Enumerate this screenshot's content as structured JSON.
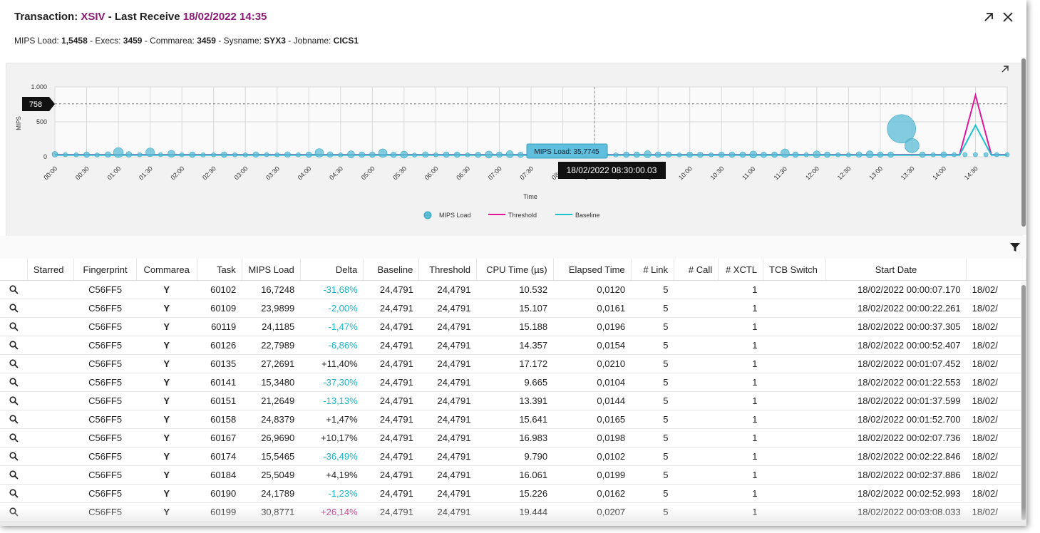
{
  "header": {
    "title_prefix": "Transaction:",
    "transaction": "XSIV",
    "mid": "- Last Receive",
    "last_receive": "18/02/2022 14:35",
    "sub": [
      {
        "label": "MIPS Load:",
        "value": "1,5458"
      },
      {
        "label": "Execs:",
        "value": "3459"
      },
      {
        "label": "Commarea:",
        "value": "3459"
      },
      {
        "label": "Sysname:",
        "value": "SYX3"
      },
      {
        "label": "Jobname:",
        "value": "CICS1"
      }
    ],
    "sep": "-"
  },
  "colors": {
    "accent": "#8c1a76",
    "mips": "#5bbcd6",
    "threshold": "#e0169b",
    "baseline": "#1bc3cf",
    "neg_delta": "#1bb4c6"
  },
  "icons": {
    "expand": "arrow-up-right-icon",
    "close": "close-icon",
    "chart_expand": "arrow-up-right-icon",
    "filter": "filter-icon",
    "row": "search-icon"
  },
  "chart_data": {
    "type": "scatter",
    "ylabel": "MIPS",
    "xlabel": "Time",
    "ylim": [
      0,
      1000
    ],
    "yticks": [
      "0",
      "500",
      "1.000"
    ],
    "xticks": [
      "00:00",
      "00:30",
      "01:00",
      "01:30",
      "02:00",
      "02:30",
      "03:00",
      "03:30",
      "04:00",
      "04:30",
      "05:00",
      "05:30",
      "06:00",
      "06:30",
      "07:00",
      "07:30",
      "08:00",
      "08:30",
      "09:00",
      "09:30",
      "10:00",
      "10:30",
      "11:00",
      "11:30",
      "12:00",
      "12:30",
      "13:00",
      "13:30",
      "14:00",
      "14:30"
    ],
    "threshold_marker": "758",
    "tooltip_series": "MIPS Load: 35,7745",
    "tooltip_time": "18/02/2022 08:30:00.03",
    "legend": [
      "MIPS Load",
      "Threshold",
      "Baseline"
    ],
    "series": [
      {
        "name": "MIPS Load",
        "kind": "bubble",
        "x": [
          0.0,
          0.33,
          0.67,
          1.0,
          1.33,
          1.67,
          2.0,
          2.33,
          2.67,
          3.0,
          3.33,
          3.67,
          4.0,
          4.33,
          4.67,
          5.0,
          5.33,
          5.67,
          6.0,
          6.33,
          6.67,
          7.0,
          7.33,
          7.67,
          8.0,
          8.33,
          8.67,
          9.0,
          9.33,
          9.67,
          10.0,
          10.33,
          10.67,
          11.0,
          11.33,
          11.67,
          12.0,
          12.33,
          12.67,
          13.0,
          13.33,
          13.67,
          14.0,
          14.33,
          14.67,
          15.0,
          15.33,
          15.67,
          16.0,
          16.33,
          16.67,
          17.0,
          17.33,
          17.67,
          18.0,
          18.33,
          18.67,
          19.0,
          19.33,
          19.67,
          20.0,
          20.33,
          20.67,
          21.0,
          21.33,
          21.67,
          22.0,
          22.33,
          22.67,
          23.0,
          23.33,
          23.67,
          24.0,
          24.33,
          24.67,
          25.0,
          25.33,
          25.67,
          26.0,
          26.33,
          26.67,
          27.0,
          27.33,
          27.67,
          28.0,
          28.33,
          28.67,
          29.0,
          29.33,
          29.67,
          30.0
        ],
        "values": [
          36,
          30,
          28,
          30,
          25,
          32,
          60,
          34,
          28,
          64,
          30,
          42,
          28,
          30,
          26,
          28,
          30,
          28,
          26,
          32,
          30,
          28,
          32,
          28,
          30,
          56,
          32,
          26,
          34,
          30,
          30,
          52,
          28,
          30,
          24,
          32,
          28,
          30,
          30,
          26,
          28,
          32,
          30,
          36,
          28,
          30,
          28,
          34,
          30,
          30,
          32,
          28,
          30,
          26,
          30,
          30,
          36,
          30,
          32,
          26,
          30,
          28,
          28,
          30,
          30,
          30,
          32,
          28,
          30,
          50,
          30,
          28,
          34,
          30,
          28,
          26,
          32,
          34,
          30,
          30,
          400,
          160,
          30,
          28,
          30,
          30,
          30,
          30,
          30,
          30,
          30
        ],
        "sizes": [
          4,
          3,
          3,
          4,
          3,
          4,
          7,
          4,
          3,
          6,
          3,
          5,
          3,
          4,
          3,
          3,
          4,
          3,
          3,
          4,
          3,
          3,
          4,
          3,
          4,
          6,
          4,
          3,
          5,
          4,
          4,
          6,
          4,
          5,
          3,
          4,
          3,
          4,
          4,
          3,
          4,
          5,
          4,
          5,
          4,
          4,
          3,
          5,
          4,
          4,
          5,
          4,
          4,
          3,
          4,
          4,
          5,
          4,
          4,
          3,
          4,
          4,
          3,
          4,
          4,
          4,
          5,
          4,
          4,
          6,
          4,
          3,
          5,
          4,
          3,
          3,
          4,
          5,
          4,
          4,
          20,
          10,
          4,
          3,
          4,
          3,
          3,
          3,
          3,
          3,
          3
        ]
      },
      {
        "name": "Threshold",
        "kind": "line",
        "x": [
          0,
          28.5,
          29,
          29.5,
          30
        ],
        "values": [
          30,
          30,
          880,
          30,
          30
        ]
      },
      {
        "name": "Baseline",
        "kind": "line",
        "x": [
          0,
          28.5,
          29,
          29.5,
          30
        ],
        "values": [
          24,
          24,
          450,
          24,
          24
        ]
      }
    ]
  },
  "table": {
    "columns": [
      "",
      "Starred",
      "Fingerprint",
      "Commarea",
      "Task",
      "MIPS Load",
      "Delta",
      "Baseline",
      "Threshold",
      "CPU Time (µs)",
      "Elapsed Time",
      "# Link",
      "# Call",
      "# XCTL",
      "TCB Switch",
      "Start Date",
      ""
    ],
    "rows": [
      {
        "fingerprint": "C56FF5",
        "commarea": "Y",
        "task": "60102",
        "mips": "16,7248",
        "delta": "-31,68%",
        "dclass": "neg",
        "baseline": "24,4791",
        "threshold": "24,4791",
        "cpu": "10.532",
        "elapsed": "0,0120",
        "link": "5",
        "call": "",
        "xctl": "1",
        "tcb": "",
        "start": "18/02/2022 00:00:07.170",
        "end": "18/02/"
      },
      {
        "fingerprint": "C56FF5",
        "commarea": "Y",
        "task": "60109",
        "mips": "23,9899",
        "delta": "-2,00%",
        "dclass": "neg",
        "baseline": "24,4791",
        "threshold": "24,4791",
        "cpu": "15.107",
        "elapsed": "0,0161",
        "link": "5",
        "call": "",
        "xctl": "1",
        "tcb": "",
        "start": "18/02/2022 00:00:22.261",
        "end": "18/02/"
      },
      {
        "fingerprint": "C56FF5",
        "commarea": "Y",
        "task": "60119",
        "mips": "24,1185",
        "delta": "-1,47%",
        "dclass": "neg",
        "baseline": "24,4791",
        "threshold": "24,4791",
        "cpu": "15.188",
        "elapsed": "0,0196",
        "link": "5",
        "call": "",
        "xctl": "1",
        "tcb": "",
        "start": "18/02/2022 00:00:37.305",
        "end": "18/02/"
      },
      {
        "fingerprint": "C56FF5",
        "commarea": "Y",
        "task": "60126",
        "mips": "22,7989",
        "delta": "-6,86%",
        "dclass": "neg",
        "baseline": "24,4791",
        "threshold": "24,4791",
        "cpu": "14.357",
        "elapsed": "0,0154",
        "link": "5",
        "call": "",
        "xctl": "1",
        "tcb": "",
        "start": "18/02/2022 00:00:52.407",
        "end": "18/02/"
      },
      {
        "fingerprint": "C56FF5",
        "commarea": "Y",
        "task": "60135",
        "mips": "27,2691",
        "delta": "+11,40%",
        "dclass": "pos",
        "baseline": "24,4791",
        "threshold": "24,4791",
        "cpu": "17.172",
        "elapsed": "0,0210",
        "link": "5",
        "call": "",
        "xctl": "1",
        "tcb": "",
        "start": "18/02/2022 00:01:07.452",
        "end": "18/02/"
      },
      {
        "fingerprint": "C56FF5",
        "commarea": "Y",
        "task": "60141",
        "mips": "15,3480",
        "delta": "-37,30%",
        "dclass": "neg",
        "baseline": "24,4791",
        "threshold": "24,4791",
        "cpu": "9.665",
        "elapsed": "0,0104",
        "link": "5",
        "call": "",
        "xctl": "1",
        "tcb": "",
        "start": "18/02/2022 00:01:22.553",
        "end": "18/02/"
      },
      {
        "fingerprint": "C56FF5",
        "commarea": "Y",
        "task": "60151",
        "mips": "21,2649",
        "delta": "-13,13%",
        "dclass": "neg",
        "baseline": "24,4791",
        "threshold": "24,4791",
        "cpu": "13.391",
        "elapsed": "0,0144",
        "link": "5",
        "call": "",
        "xctl": "1",
        "tcb": "",
        "start": "18/02/2022 00:01:37.599",
        "end": "18/02/"
      },
      {
        "fingerprint": "C56FF5",
        "commarea": "Y",
        "task": "60158",
        "mips": "24,8379",
        "delta": "+1,47%",
        "dclass": "pos",
        "baseline": "24,4791",
        "threshold": "24,4791",
        "cpu": "15.641",
        "elapsed": "0,0165",
        "link": "5",
        "call": "",
        "xctl": "1",
        "tcb": "",
        "start": "18/02/2022 00:01:52.700",
        "end": "18/02/"
      },
      {
        "fingerprint": "C56FF5",
        "commarea": "Y",
        "task": "60167",
        "mips": "26,9690",
        "delta": "+10,17%",
        "dclass": "pos",
        "baseline": "24,4791",
        "threshold": "24,4791",
        "cpu": "16.983",
        "elapsed": "0,0198",
        "link": "5",
        "call": "",
        "xctl": "1",
        "tcb": "",
        "start": "18/02/2022 00:02:07.736",
        "end": "18/02/"
      },
      {
        "fingerprint": "C56FF5",
        "commarea": "Y",
        "task": "60174",
        "mips": "15,5465",
        "delta": "-36,49%",
        "dclass": "neg",
        "baseline": "24,4791",
        "threshold": "24,4791",
        "cpu": "9.790",
        "elapsed": "0,0102",
        "link": "5",
        "call": "",
        "xctl": "1",
        "tcb": "",
        "start": "18/02/2022 00:02:22.846",
        "end": "18/02/"
      },
      {
        "fingerprint": "C56FF5",
        "commarea": "Y",
        "task": "60184",
        "mips": "25,5049",
        "delta": "+4,19%",
        "dclass": "pos",
        "baseline": "24,4791",
        "threshold": "24,4791",
        "cpu": "16.061",
        "elapsed": "0,0199",
        "link": "5",
        "call": "",
        "xctl": "1",
        "tcb": "",
        "start": "18/02/2022 00:02:37.886",
        "end": "18/02/"
      },
      {
        "fingerprint": "C56FF5",
        "commarea": "Y",
        "task": "60190",
        "mips": "24,1789",
        "delta": "-1,23%",
        "dclass": "neg",
        "baseline": "24,4791",
        "threshold": "24,4791",
        "cpu": "15.226",
        "elapsed": "0,0162",
        "link": "5",
        "call": "",
        "xctl": "1",
        "tcb": "",
        "start": "18/02/2022 00:02:52.993",
        "end": "18/02/"
      },
      {
        "fingerprint": "C56FF5",
        "commarea": "Y",
        "task": "60199",
        "mips": "30,8771",
        "delta": "+26,14%",
        "dclass": "hi",
        "baseline": "24,4791",
        "threshold": "24,4791",
        "cpu": "19.444",
        "elapsed": "0,0207",
        "link": "5",
        "call": "",
        "xctl": "1",
        "tcb": "",
        "start": "18/02/2022 00:03:08.033",
        "end": "18/02/"
      }
    ]
  }
}
